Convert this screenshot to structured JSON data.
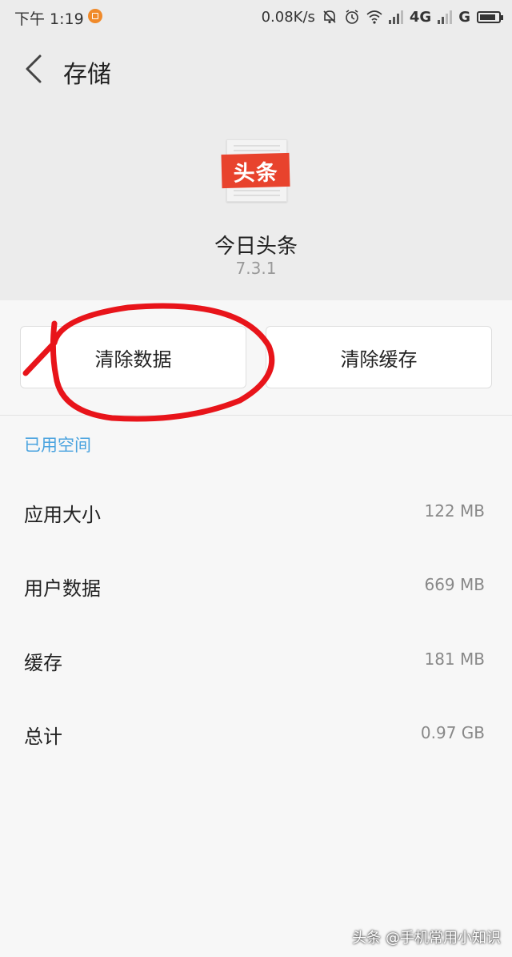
{
  "status_bar": {
    "time": "下午 1:19",
    "network_speed": "0.08K/s",
    "network_4g": "4G",
    "network_g": "G"
  },
  "nav": {
    "title": "存储"
  },
  "app": {
    "icon_text": "头条",
    "name": "今日头条",
    "version": "7.3.1"
  },
  "actions": {
    "clear_data": "清除数据",
    "clear_cache": "清除缓存"
  },
  "storage": {
    "header": "已用空间",
    "rows": [
      {
        "label": "应用大小",
        "value": "122 MB"
      },
      {
        "label": "用户数据",
        "value": "669 MB"
      },
      {
        "label": "缓存",
        "value": "181 MB"
      },
      {
        "label": "总计",
        "value": "0.97 GB"
      }
    ]
  },
  "watermark": "头条 @手机常用小知识",
  "colors": {
    "accent": "#4aa3df",
    "annotation": "#e8141a",
    "app_red": "#e8432d"
  }
}
